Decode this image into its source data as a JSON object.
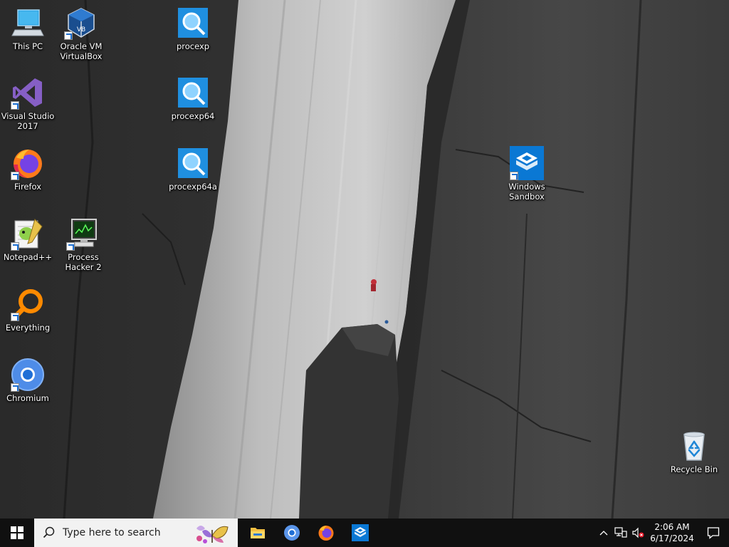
{
  "desktop": {
    "icons": [
      {
        "id": "this-pc",
        "label": "This PC"
      },
      {
        "id": "virtualbox",
        "label": "Oracle VM\nVirtualBox"
      },
      {
        "id": "procexp",
        "label": "procexp"
      },
      {
        "id": "visual-studio",
        "label": "Visual Studio\n2017"
      },
      {
        "id": "procexp64",
        "label": "procexp64"
      },
      {
        "id": "firefox",
        "label": "Firefox"
      },
      {
        "id": "procexp64a",
        "label": "procexp64a"
      },
      {
        "id": "windows-sandbox",
        "label": "Windows\nSandbox"
      },
      {
        "id": "notepadpp",
        "label": "Notepad++"
      },
      {
        "id": "process-hacker",
        "label": "Process\nHacker 2"
      },
      {
        "id": "everything",
        "label": "Everything"
      },
      {
        "id": "chromium",
        "label": "Chromium"
      },
      {
        "id": "recycle-bin",
        "label": "Recycle Bin"
      }
    ]
  },
  "taskbar": {
    "search_placeholder": "Type here to search",
    "pinned": [
      "file-explorer",
      "chromium",
      "firefox",
      "windows-sandbox"
    ],
    "clock": {
      "time": "2:06 AM",
      "date": "6/17/2024"
    }
  },
  "colors": {
    "taskbar": "#101010",
    "accent": "#0078d7"
  }
}
